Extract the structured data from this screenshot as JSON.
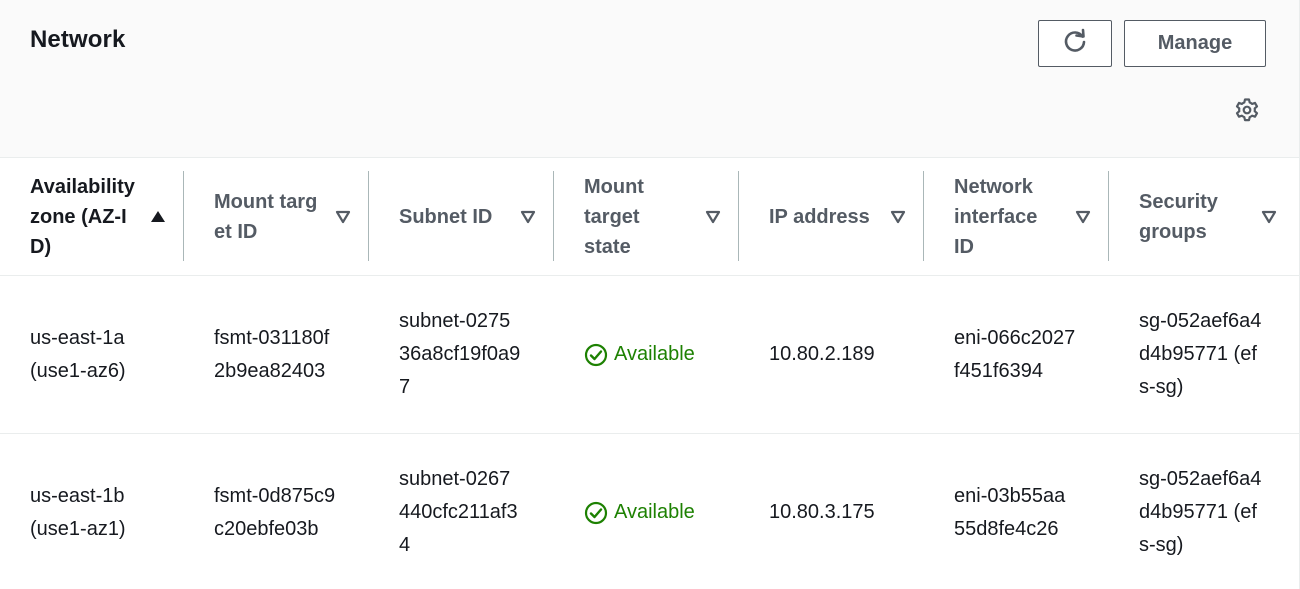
{
  "header": {
    "title": "Network",
    "manage_label": "Manage",
    "refresh_icon": "refresh-icon",
    "settings_icon": "gear-icon"
  },
  "colors": {
    "status_available": "#1d8102",
    "header_text": "#545b64",
    "body_text": "#16191f"
  },
  "table": {
    "columns": [
      {
        "label": "Availability zone (AZ-ID)",
        "sort": "ascending"
      },
      {
        "label": "Mount target ID",
        "sort": "none"
      },
      {
        "label": "Subnet ID",
        "sort": "none"
      },
      {
        "label": "Mount target state",
        "sort": "none"
      },
      {
        "label": "IP address",
        "sort": "none"
      },
      {
        "label": "Network interface ID",
        "sort": "none"
      },
      {
        "label": "Security groups",
        "sort": "none"
      }
    ],
    "rows": [
      {
        "az": "us-east-1a (use1-az6)",
        "mount_target_id": "fsmt-031180f2b9ea82403",
        "subnet_id": "subnet-027536a8cf19f0a97",
        "state": "Available",
        "ip": "10.80.2.189",
        "eni": "eni-066c2027f451f6394",
        "security_groups": "sg-052aef6a4d4b95771 (efs-sg)"
      },
      {
        "az": "us-east-1b (use1-az1)",
        "mount_target_id": "fsmt-0d875c9c20ebfe03b",
        "subnet_id": "subnet-0267440cfc211af34",
        "state": "Available",
        "ip": "10.80.3.175",
        "eni": "eni-03b55aa55d8fe4c26",
        "security_groups": "sg-052aef6a4d4b95771 (efs-sg)"
      }
    ]
  }
}
